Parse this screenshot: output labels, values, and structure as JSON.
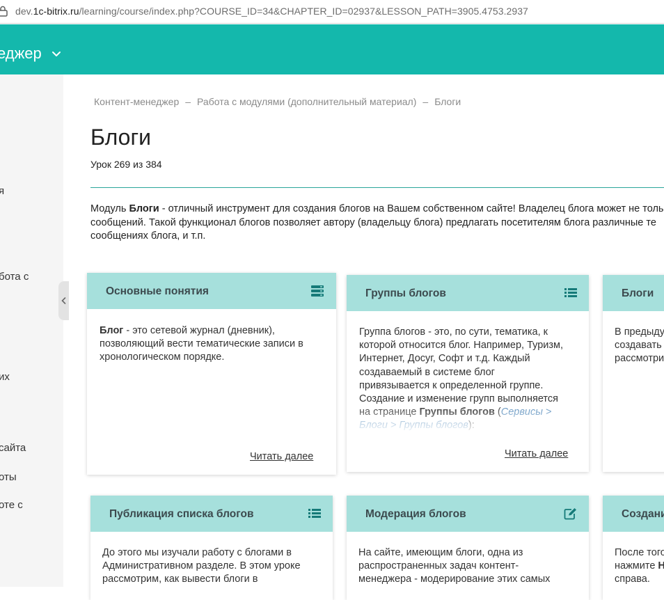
{
  "browser": {
    "url_prefix": "dev.",
    "url_host": "1c-bitrix.ru",
    "url_rest": "/learning/course/index.php?COURSE_ID=34&CHAPTER_ID=02937&LESSON_PATH=3905.4753.2937"
  },
  "header": {
    "title": "еджер"
  },
  "sidebar": {
    "items": [
      {
        "label": "я"
      },
      {
        "label": "бота с"
      },
      {
        "label": "их"
      },
      {
        "label": " сайта"
      },
      {
        "label": "оты"
      },
      {
        "label": "оте с"
      }
    ]
  },
  "breadcrumb": {
    "items": [
      "Контент-менеджер",
      "Работа с модулями (дополнительный материал)",
      "Блоги"
    ],
    "separator": "–"
  },
  "page": {
    "title": "Блоги",
    "lesson_count": "Урок 269 из 384"
  },
  "intro": {
    "line1_pre": "Модуль ",
    "line1_bold": "Блоги",
    "line1_post": " - отличный инструмент для создания блогов на Вашем собственном сайте! Владелец блога может не толь",
    "line2": "сообщений. Такой функционал блогов позволяет автору (владельцу блога) предлагать посетителям блога различные те",
    "line3": "сообщениях блога, и т.п."
  },
  "cards": [
    {
      "title": "Основные понятия",
      "icon": "server-icon",
      "body_bold": "Блог",
      "body_text": " - это сетевой журнал (дневник), позволяющий вести тематические записи в хронологическом порядке.",
      "read_more": "Читать далее"
    },
    {
      "title": "Группы блогов",
      "icon": "list-icon",
      "body_text": "Группа блогов - это, по сути, тематика, к которой относится блог. Например, Туризм, Интернет, Досуг, Софт и т.д. Каждый создаваемый в системе блог привязывается к определенной группе. Создание и изменение групп выполняется на странице ",
      "body_bold": "Группы блогов",
      "body_paren_open": " (",
      "body_link": "Сервисы > Блоги > Группы блогов",
      "body_paren_close": "):",
      "read_more": "Читать далее"
    },
    {
      "title": "Блоги",
      "line1": "В предыду",
      "line2": "создавать",
      "line3": "рассмотри"
    },
    {
      "title": "Публикация списка блогов",
      "icon": "list-icon",
      "line1": "До этого мы изучали работу с блогами в",
      "line2": "Административном разделе. В этом уроке",
      "line3": "рассмотрим, как вывести блоги в"
    },
    {
      "title": "Модерация блогов",
      "icon": "edit-icon",
      "line1": "На сайте, имеющим блоги, одна из",
      "line2": "распространенных задач контент-",
      "line3": "менеджера - модерирование этих самых"
    },
    {
      "title": "Создани",
      "line1": "После того",
      "line2_pre": "нажмите ",
      "line2_bold": "Н",
      "line3": "справа."
    }
  ]
}
